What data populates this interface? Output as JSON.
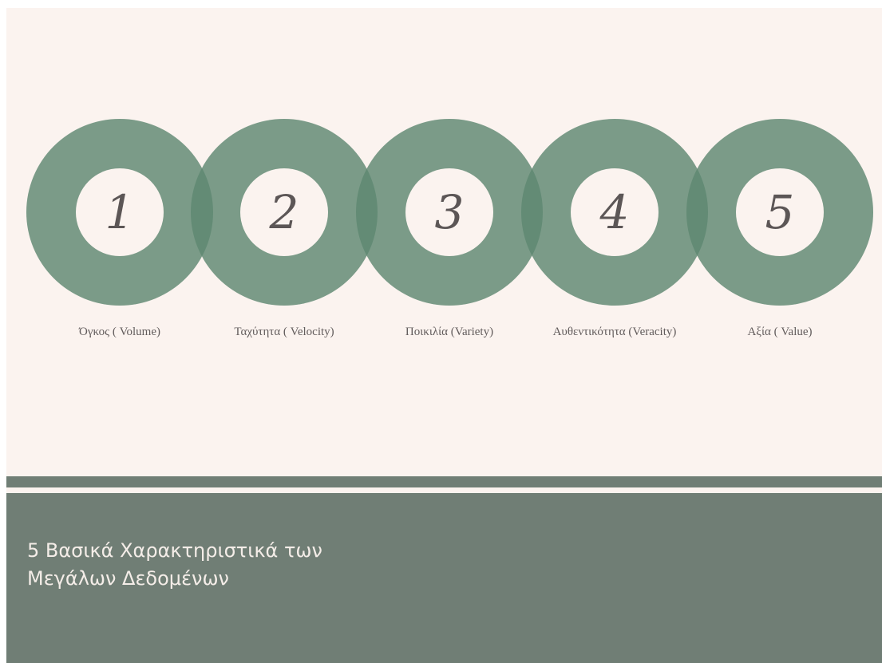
{
  "steps": [
    {
      "number": "1",
      "label": "Όγκος ( Volume)"
    },
    {
      "number": "2",
      "label": "Ταχύτητα ( Velocity)"
    },
    {
      "number": "3",
      "label": "Ποικιλία (Variety)"
    },
    {
      "number": "4",
      "label": "Αυθεντικότητα (Veracity)"
    },
    {
      "number": "5",
      "label": "Αξία ( Value)"
    }
  ],
  "title": {
    "line1": "5 Βασικά Χαρακτηριστικά των",
    "line2": "Μεγάλων Δεδομένων"
  },
  "colors": {
    "background": "#fbf3ef",
    "ring": "#5e8771",
    "footer": "#707e75",
    "number_text": "#5c5656",
    "title_text": "#f4ede8"
  }
}
